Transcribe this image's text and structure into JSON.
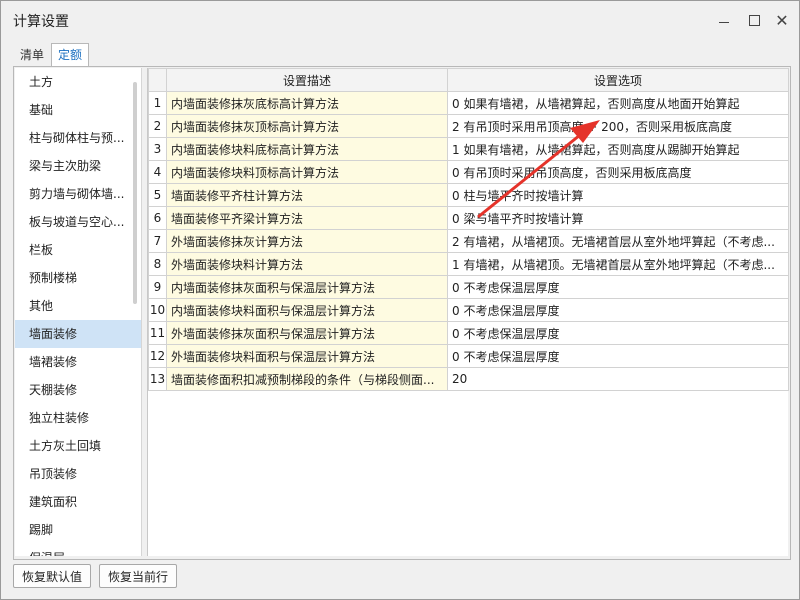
{
  "window": {
    "title": "计算设置"
  },
  "tabs": [
    {
      "label": "清单",
      "active": false
    },
    {
      "label": "定额",
      "active": true
    }
  ],
  "sidebar": {
    "items": [
      {
        "label": "土方"
      },
      {
        "label": "基础"
      },
      {
        "label": "柱与砌体柱与预..."
      },
      {
        "label": "梁与主次肋梁"
      },
      {
        "label": "剪力墙与砌体墙..."
      },
      {
        "label": "板与坡道与空心..."
      },
      {
        "label": "栏板"
      },
      {
        "label": "预制楼梯"
      },
      {
        "label": "其他"
      },
      {
        "label": "墙面装修",
        "selected": true
      },
      {
        "label": "墙裙装修"
      },
      {
        "label": "天棚装修"
      },
      {
        "label": "独立柱装修"
      },
      {
        "label": "土方灰土回填"
      },
      {
        "label": "吊顶装修"
      },
      {
        "label": "建筑面积"
      },
      {
        "label": "踢脚"
      },
      {
        "label": "保温层"
      }
    ]
  },
  "grid": {
    "columns": [
      "",
      "设置描述",
      "设置选项"
    ],
    "rows": [
      {
        "num": "1",
        "desc": "内墙面装修抹灰底标高计算方法",
        "opt": "0 如果有墙裙，从墙裙算起，否则高度从地面开始算起"
      },
      {
        "num": "2",
        "desc": "内墙面装修抹灰顶标高计算方法",
        "opt": "2 有吊顶时采用吊顶高度 + 200，否则采用板底高度"
      },
      {
        "num": "3",
        "desc": "内墙面装修块料底标高计算方法",
        "opt": "1 如果有墙裙，从墙裙算起，否则高度从踢脚开始算起"
      },
      {
        "num": "4",
        "desc": "内墙面装修块料顶标高计算方法",
        "opt": "0 有吊顶时采用吊顶高度，否则采用板底高度"
      },
      {
        "num": "5",
        "desc": "墙面装修平齐柱计算方法",
        "opt": "0 柱与墙平齐时按墙计算"
      },
      {
        "num": "6",
        "desc": "墙面装修平齐梁计算方法",
        "opt": "0 梁与墙平齐时按墙计算"
      },
      {
        "num": "7",
        "desc": "外墙面装修抹灰计算方法",
        "opt": "2 有墙裙，从墙裙顶。无墙裙首层从室外地坪算起（不考虑..."
      },
      {
        "num": "8",
        "desc": "外墙面装修块料计算方法",
        "opt": "1 有墙裙，从墙裙顶。无墙裙首层从室外地坪算起（不考虑..."
      },
      {
        "num": "9",
        "desc": "内墙面装修抹灰面积与保温层计算方法",
        "opt": "0 不考虑保温层厚度"
      },
      {
        "num": "10",
        "desc": "内墙面装修块料面积与保温层计算方法",
        "opt": "0 不考虑保温层厚度"
      },
      {
        "num": "11",
        "desc": "外墙面装修抹灰面积与保温层计算方法",
        "opt": "0 不考虑保温层厚度"
      },
      {
        "num": "12",
        "desc": "外墙面装修块料面积与保温层计算方法",
        "opt": "0 不考虑保温层厚度"
      },
      {
        "num": "13",
        "desc": "墙面装修面积扣减预制梯段的条件（与梯段侧面...",
        "opt": "20"
      }
    ]
  },
  "footer": {
    "restore_default_label": "恢复默认值",
    "restore_row_label": "恢复当前行"
  },
  "colors": {
    "accent": "#1a6fc0",
    "selected_row": "#cfe3f6",
    "desc_cell": "#fefbe1",
    "annotation_arrow": "#e5332a"
  }
}
